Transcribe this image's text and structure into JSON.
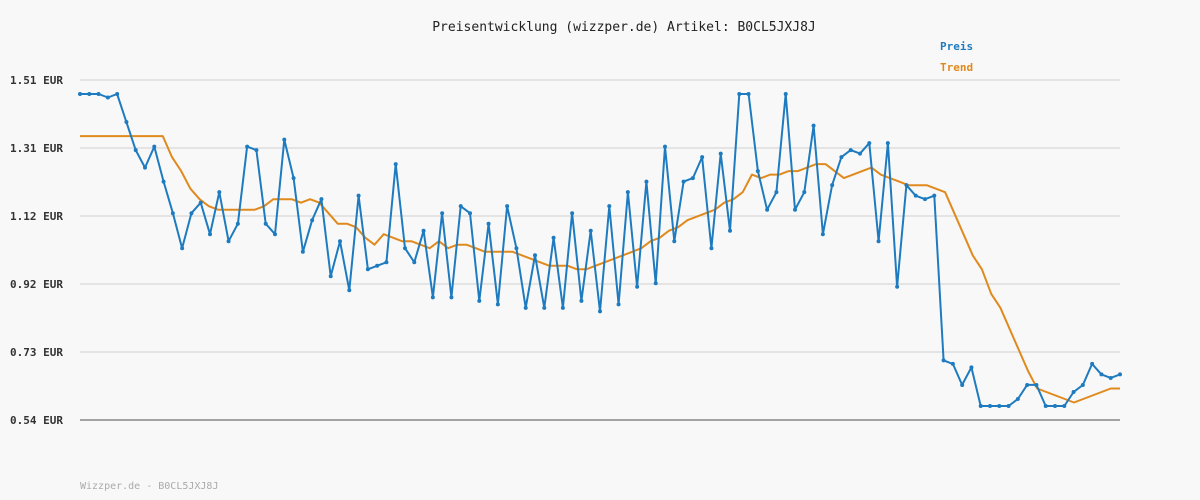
{
  "colors": {
    "preis": "#1e7bbf",
    "trend": "#e08a1e",
    "grid": "#dddddd",
    "axis": "#888888"
  },
  "chart_data": {
    "type": "line",
    "title": "Preisentwicklung (wizzper.de) Artikel: B0CL5JXJ8J",
    "yticks": [
      "0.54 EUR",
      "0.73 EUR",
      "0.92 EUR",
      "1.12 EUR",
      "1.31 EUR",
      "1.51 EUR"
    ],
    "ylim": [
      0.54,
      1.51
    ],
    "grid": true,
    "legend_position": "top-right",
    "series": [
      {
        "name": "Preis",
        "values": [
          1.47,
          1.47,
          1.47,
          1.46,
          1.47,
          1.39,
          1.31,
          1.26,
          1.32,
          1.22,
          1.13,
          1.03,
          1.13,
          1.16,
          1.07,
          1.19,
          1.05,
          1.1,
          1.32,
          1.31,
          1.1,
          1.07,
          1.34,
          1.23,
          1.02,
          1.11,
          1.17,
          0.95,
          1.05,
          0.91,
          1.18,
          0.97,
          0.98,
          0.99,
          1.27,
          1.03,
          0.99,
          1.08,
          0.89,
          1.13,
          0.89,
          1.15,
          1.13,
          0.88,
          1.1,
          0.87,
          1.15,
          1.03,
          0.86,
          1.01,
          0.86,
          1.06,
          0.86,
          1.13,
          0.88,
          1.08,
          0.85,
          1.15,
          0.87,
          1.19,
          0.92,
          1.22,
          0.93,
          1.32,
          1.05,
          1.22,
          1.23,
          1.29,
          1.03,
          1.3,
          1.08,
          1.47,
          1.47,
          1.25,
          1.14,
          1.19,
          1.47,
          1.14,
          1.19,
          1.38,
          1.07,
          1.21,
          1.29,
          1.31,
          1.3,
          1.33,
          1.05,
          1.33,
          0.92,
          1.21,
          1.18,
          1.17,
          1.18,
          0.71,
          0.7,
          0.64,
          0.69,
          0.58,
          0.58,
          0.58,
          0.58,
          0.6,
          0.64,
          0.64,
          0.58,
          0.58,
          0.58,
          0.62,
          0.64,
          0.7,
          0.67,
          0.66,
          0.67
        ]
      },
      {
        "name": "Trend",
        "values": [
          1.35,
          1.35,
          1.35,
          1.35,
          1.35,
          1.35,
          1.35,
          1.35,
          1.35,
          1.35,
          1.29,
          1.25,
          1.2,
          1.17,
          1.15,
          1.14,
          1.14,
          1.14,
          1.14,
          1.14,
          1.15,
          1.17,
          1.17,
          1.17,
          1.16,
          1.17,
          1.16,
          1.13,
          1.1,
          1.1,
          1.09,
          1.06,
          1.04,
          1.07,
          1.06,
          1.05,
          1.05,
          1.04,
          1.03,
          1.05,
          1.03,
          1.04,
          1.04,
          1.03,
          1.02,
          1.02,
          1.02,
          1.02,
          1.01,
          1.0,
          0.99,
          0.98,
          0.98,
          0.98,
          0.97,
          0.97,
          0.98,
          0.99,
          1.0,
          1.01,
          1.02,
          1.03,
          1.05,
          1.06,
          1.08,
          1.09,
          1.11,
          1.12,
          1.13,
          1.14,
          1.16,
          1.17,
          1.19,
          1.24,
          1.23,
          1.24,
          1.24,
          1.25,
          1.25,
          1.26,
          1.27,
          1.27,
          1.25,
          1.23,
          1.24,
          1.25,
          1.26,
          1.24,
          1.23,
          1.22,
          1.21,
          1.21,
          1.21,
          1.2,
          1.19,
          1.13,
          1.07,
          1.01,
          0.97,
          0.9,
          0.86,
          0.8,
          0.74,
          0.68,
          0.63,
          0.62,
          0.61,
          0.6,
          0.59,
          0.6,
          0.61,
          0.62,
          0.63,
          0.63
        ]
      }
    ]
  },
  "footer": "Wizzper.de - B0CL5JXJ8J"
}
